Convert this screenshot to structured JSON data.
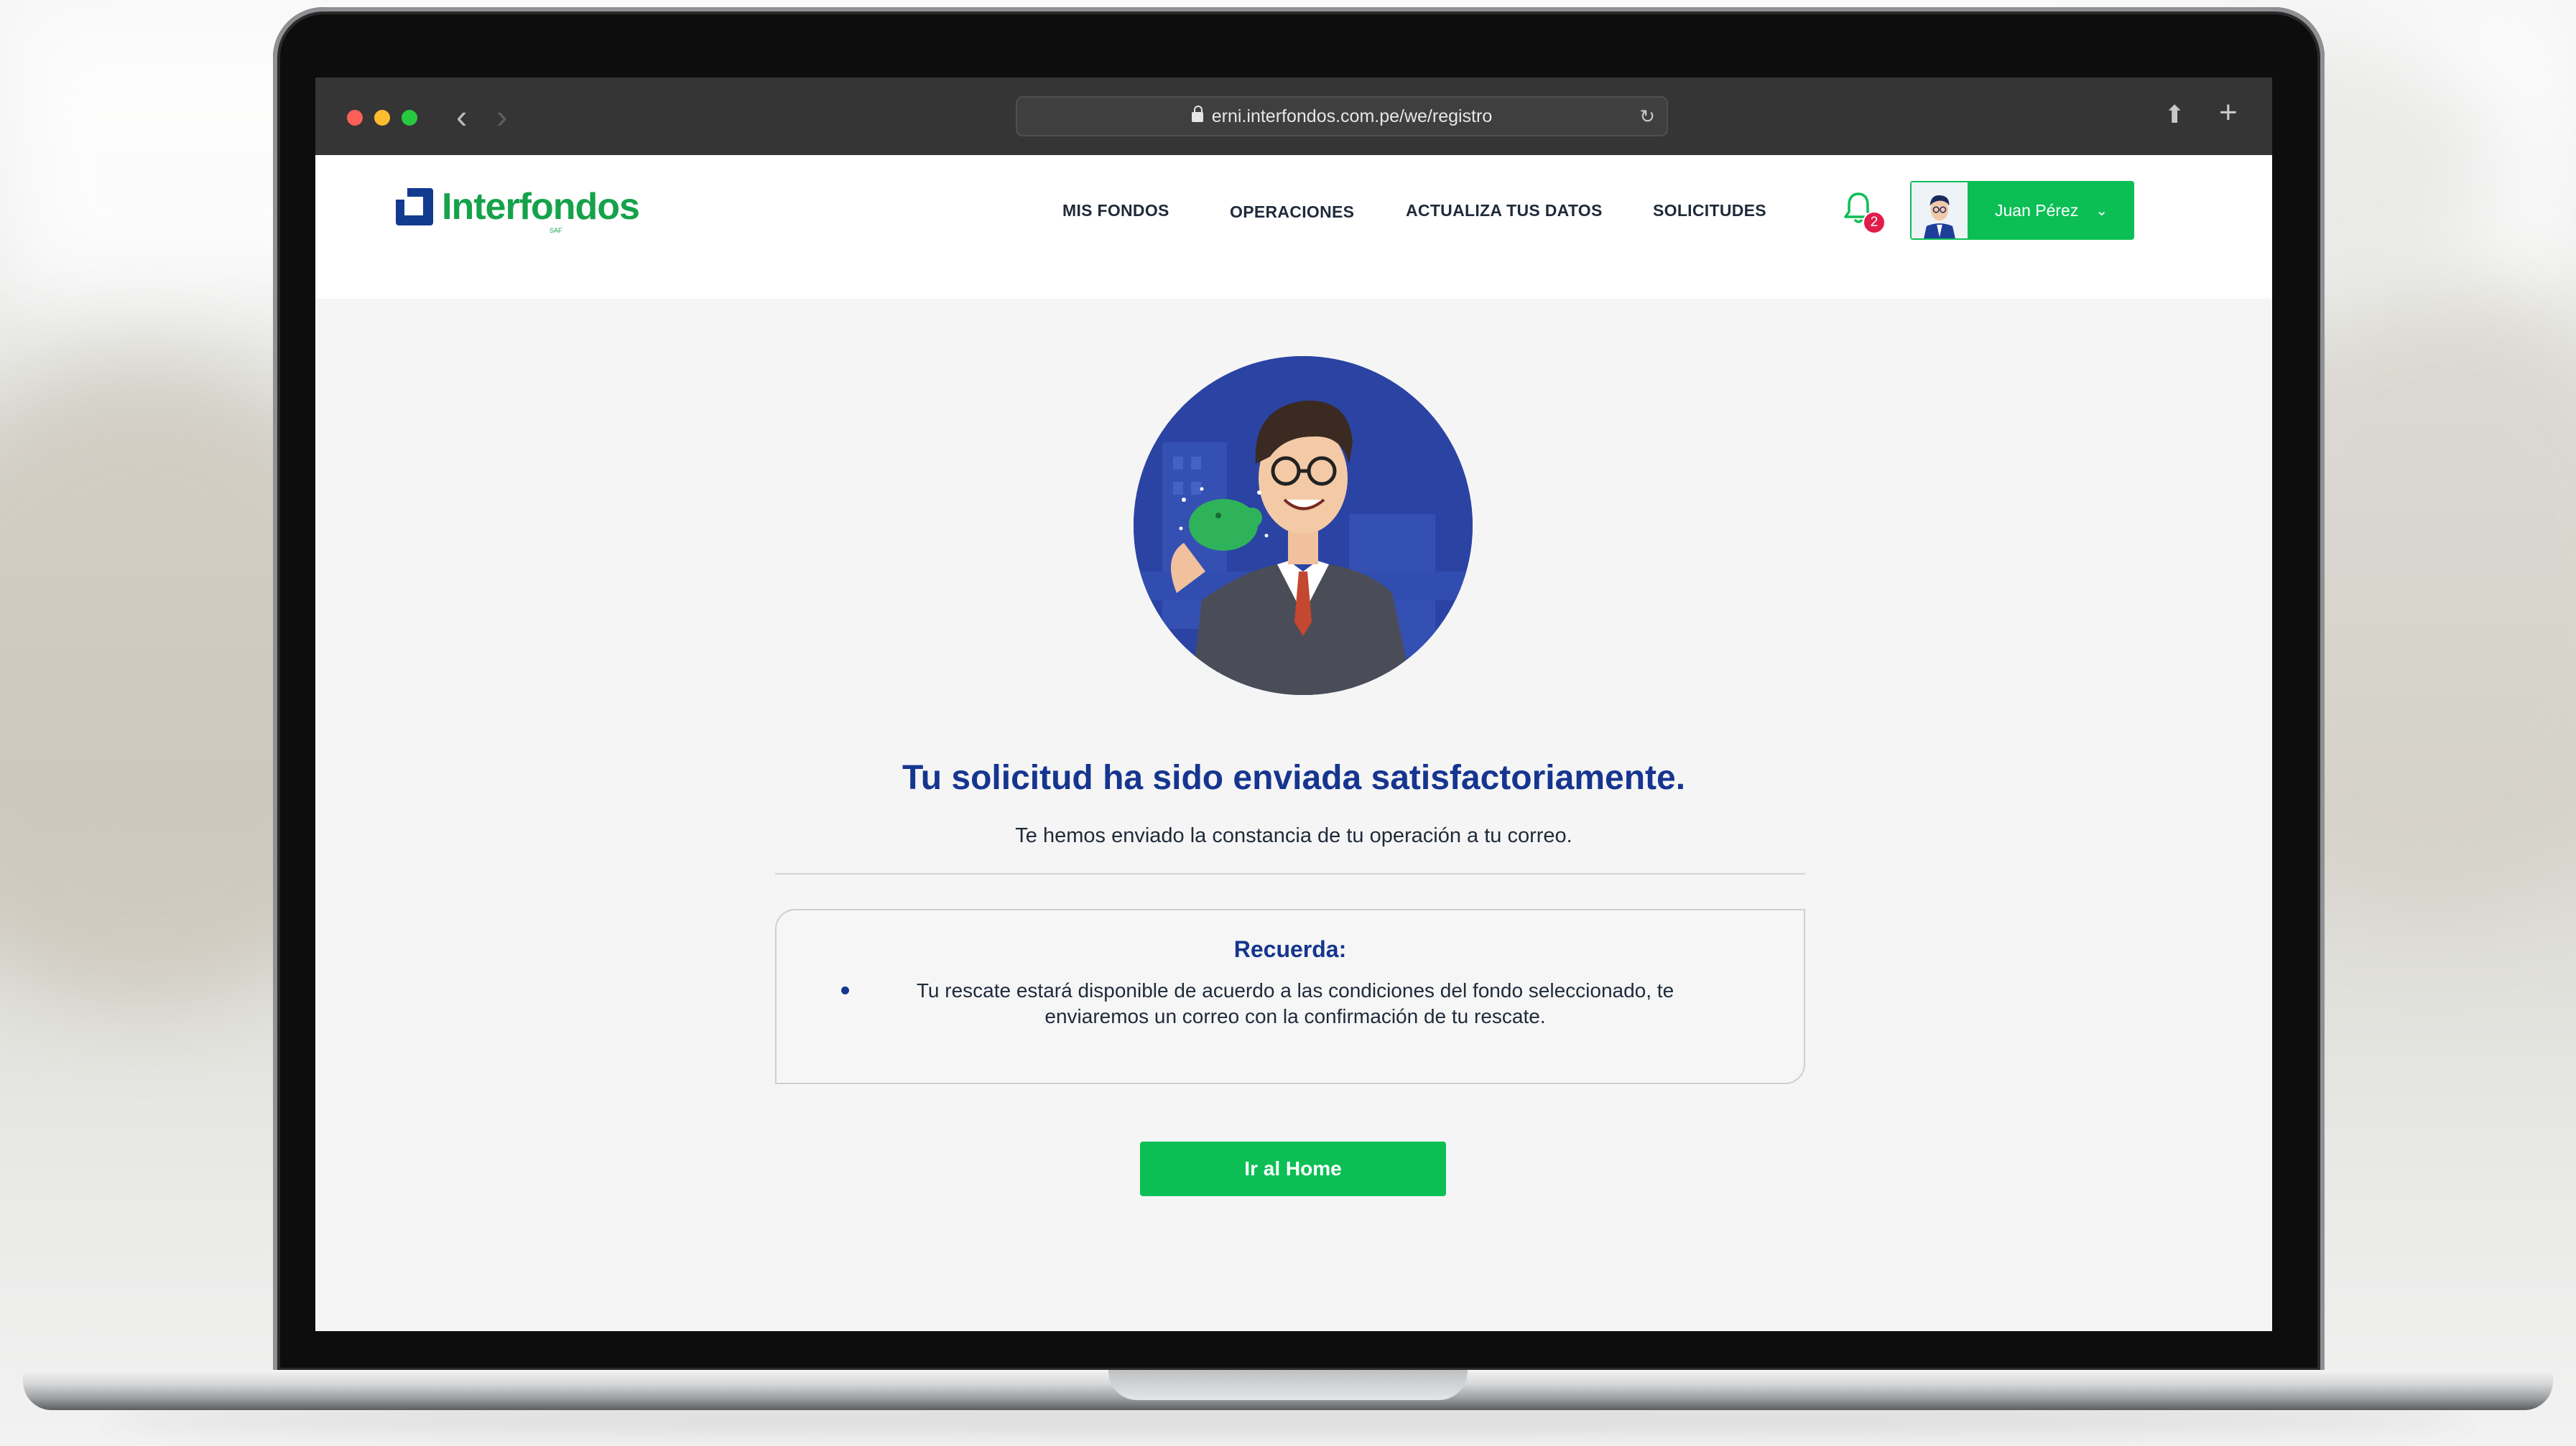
{
  "browser": {
    "url": "erni.interfondos.com.pe/we/registro",
    "icons": [
      "close-dot",
      "minimize-dot",
      "zoom-dot",
      "back-icon",
      "forward-icon",
      "lock-icon",
      "reload-icon",
      "share-icon",
      "new-tab-icon"
    ]
  },
  "header": {
    "logo": {
      "brand": "Interfondos",
      "sub": "SAF"
    },
    "menu": [
      "MIS FONDOS",
      "OPERACIONES",
      "ACTUALIZA TUS DATOS",
      "SOLICITUDES"
    ],
    "notifications": {
      "count": "2"
    },
    "user": {
      "name": "Juan Pérez"
    }
  },
  "main": {
    "title": "Tu solicitud ha sido enviada satisfactoriamente.",
    "subtitle": "Te hemos enviado la constancia de tu operación a tu correo.",
    "reminder": {
      "title": "Recuerda:",
      "items": [
        "Tu rescate estará disponible de acuerdo a las condiciones del fondo seleccionado, te enviaremos un correo con la confirmación de tu rescate."
      ]
    },
    "cta": "Ir al Home"
  },
  "colors": {
    "brand_green": "#0bbf55",
    "brand_blue": "#15358f",
    "badge_red": "#e01d4b"
  }
}
